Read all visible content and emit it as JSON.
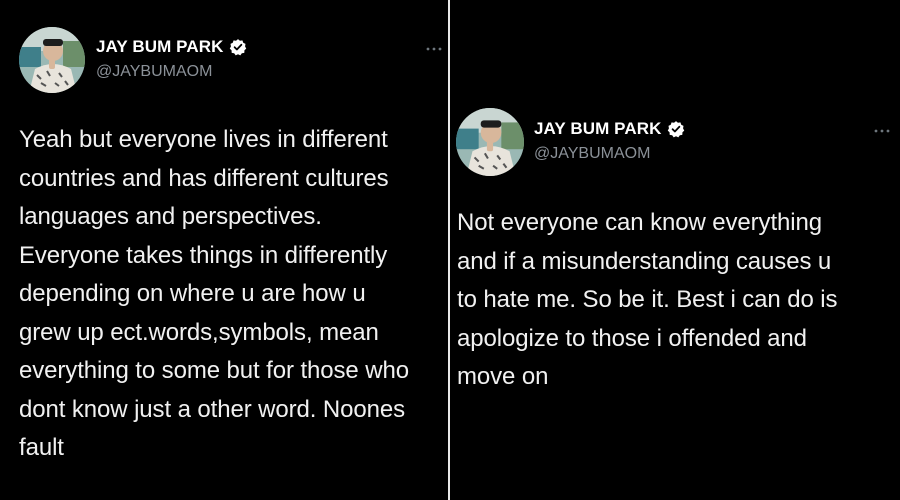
{
  "tweets": [
    {
      "author": {
        "display_name": "JAY BUM PARK",
        "handle": "@JAYBUMAOM",
        "verified": true
      },
      "more_icon": "more-horizontal-icon",
      "text": "Yeah but everyone lives in different\ncountries and has different cultures\nlanguages and perspectives.\nEveryone takes things in differently\ndepending on where u are how u\ngrew up ect.words,symbols, mean\neverything to some but for those who\ndont know just a other word. Noones\nfault"
    },
    {
      "author": {
        "display_name": "JAY BUM PARK",
        "handle": "@JAYBUMAOM",
        "verified": true
      },
      "more_icon": "more-horizontal-icon",
      "text": "Not everyone can know everything\nand if a misunderstanding causes u\nto hate me. So be it. Best i can do is\napologize to those i offended and\nmove on"
    }
  ],
  "colors": {
    "background": "#000000",
    "text": "#f1f1f1",
    "handle": "#8b9198",
    "divider": "#e9e9e9"
  }
}
